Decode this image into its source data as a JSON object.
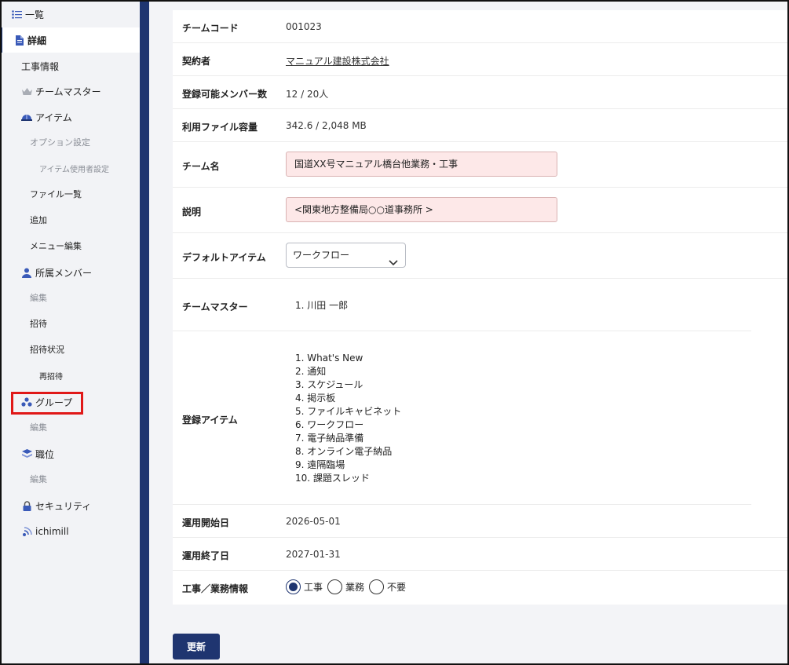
{
  "sidebar": {
    "items": [
      {
        "label": "一覧",
        "icon": "list-icon"
      },
      {
        "label": "詳細",
        "icon": "document-icon"
      },
      {
        "label": "工事情報"
      },
      {
        "label": "チームマスター",
        "icon": "crown-icon"
      },
      {
        "label": "アイテム",
        "icon": "helmet-icon"
      },
      {
        "label": "オプション設定"
      },
      {
        "label": "アイテム使用者設定"
      },
      {
        "label": "ファイル一覧"
      },
      {
        "label": "追加"
      },
      {
        "label": "メニュー編集"
      },
      {
        "label": "所属メンバー",
        "icon": "person-icon"
      },
      {
        "label": "編集"
      },
      {
        "label": "招待"
      },
      {
        "label": "招待状況"
      },
      {
        "label": "再招待"
      },
      {
        "label": "グループ",
        "icon": "group-icon"
      },
      {
        "label": "編集"
      },
      {
        "label": "職位",
        "icon": "layers-icon"
      },
      {
        "label": "編集"
      },
      {
        "label": "セキュリティ",
        "icon": "lock-icon"
      },
      {
        "label": "ichimill",
        "icon": "signal-icon"
      }
    ]
  },
  "colors": {
    "accent": "#1f3570",
    "highlight": "#e01818",
    "link": "#2a4fd0",
    "input_bg": "#fde8e8"
  },
  "detail": {
    "team_code": {
      "label": "チームコード",
      "value": "001023"
    },
    "contractor": {
      "label": "契約者",
      "value": "マニュアル建設株式会社"
    },
    "members": {
      "label": "登録可能メンバー数",
      "value": "12 / 20人"
    },
    "storage": {
      "label": "利用ファイル容量",
      "value": "342.6 / 2,048 MB"
    },
    "team_name": {
      "label": "チーム名",
      "value": "国道XX号マニュアル橋台他業務・工事"
    },
    "description": {
      "label": "説明",
      "value": "<関東地方整備局○○道事務所 >"
    },
    "default_item": {
      "label": "デフォルトアイテム",
      "value": "ワークフロー"
    },
    "team_master": {
      "label": "チームマスター",
      "items": [
        "1. 川田 一郎"
      ]
    },
    "registered_items": {
      "label": "登録アイテム",
      "items": [
        "1. What's New",
        "2. 通知",
        "3. スケジュール",
        "4. 掲示板",
        "5. ファイルキャビネット",
        "6. ワークフロー",
        "7. 電子納品準備",
        "8. オンライン電子納品",
        "9. 遠隔臨場",
        "10. 課題スレッド"
      ]
    },
    "start_date": {
      "label": "運用開始日",
      "value": "2026-05-01"
    },
    "end_date": {
      "label": "運用終了日",
      "value": "2027-01-31"
    },
    "work_type": {
      "label": "工事／業務情報",
      "options": [
        "工事",
        "業務",
        "不要"
      ],
      "selected": "工事"
    }
  },
  "actions": {
    "update_label": "更新"
  }
}
